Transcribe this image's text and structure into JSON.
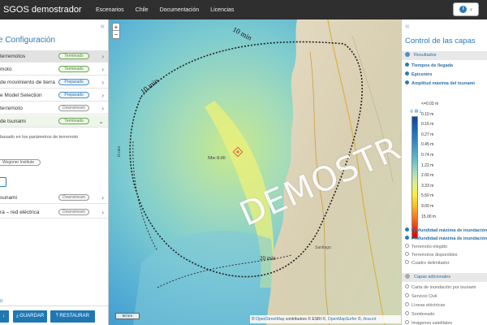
{
  "app": {
    "title": "SGOS demostrador",
    "nav": [
      "Escenarios",
      "Chile",
      "Documentación",
      "Licencias"
    ]
  },
  "left_panel": {
    "title": "e Configuración",
    "workflow": [
      {
        "label": "terremotos",
        "status": "Terminado",
        "state": "selected"
      },
      {
        "label": "moto",
        "status": "Terminado",
        "state": "normal"
      },
      {
        "label": "de movimiento de tierra",
        "status": "Preparado",
        "state": "normal"
      },
      {
        "label": "e Model Selection",
        "status": "Preparado",
        "state": "normal"
      },
      {
        "label": "terremoto",
        "status": "Downstream",
        "state": "normal"
      },
      {
        "label": "de tsunami",
        "status": "Terminado",
        "state": "open"
      }
    ],
    "sub_text": "basado en los parámetros de terremoto",
    "sub_tag": "Wegener Institute",
    "workflow_after": [
      {
        "label": "sunami",
        "status": "Downstream"
      },
      {
        "label": "ra – red eléctrica",
        "status": "Downstream"
      }
    ],
    "footer_label": "n",
    "buttons": {
      "save": "GUARDAR",
      "restore": "RESTAURAR"
    }
  },
  "map": {
    "zoom_in": "+",
    "zoom_out": "−",
    "scale_label": "50 km",
    "contour_labels": [
      "10 min",
      "10 min",
      "20 min",
      "10 min"
    ],
    "epicenter_label": "Mw 8.00",
    "place_labels": [
      "Santiago"
    ],
    "watermark": "DEMOSTRADOR",
    "attribution": {
      "prefix": "©",
      "osm": "OpenStreetMap",
      "mid": " contributors © ESRI ©,",
      "surfer": "OpenMapSurfer",
      "tail": " ©, ",
      "iho": "ihoa.int"
    }
  },
  "right_panel": {
    "title": "Control de las capas",
    "results_header": "Resultados",
    "result_layers": [
      {
        "label": "Tiempos de llegada",
        "on": true
      },
      {
        "label": "Epicentro",
        "on": true
      },
      {
        "label": "Amplitud máxima del tsunami",
        "on": true
      }
    ],
    "legend_tools": "◎ ▤ ⤓",
    "legend": [
      {
        "label": "<=0.03 m",
        "color": "#0d47a1"
      },
      {
        "label": "0.10 m",
        "color": "#1e63b0"
      },
      {
        "label": "0.16 m",
        "color": "#2f7fc0"
      },
      {
        "label": "0.27 m",
        "color": "#4aa0c6"
      },
      {
        "label": "0.45 m",
        "color": "#6cc0c8"
      },
      {
        "label": "0.74 m",
        "color": "#a6dcbc"
      },
      {
        "label": "1.22 m",
        "color": "#d8ef92"
      },
      {
        "label": "2.00 m",
        "color": "#f7f03c"
      },
      {
        "label": "3.33 m",
        "color": "#fcc02a"
      },
      {
        "label": "5.50 m",
        "color": "#f88020"
      },
      {
        "label": "9.00 m",
        "color": "#ee3b14"
      },
      {
        "label": "15.00 m",
        "color": "#d00000"
      }
    ],
    "more_results": [
      {
        "label": "Profundidad máxima de inundación",
        "on": true
      },
      {
        "label": "Profundidad máxima de inundación",
        "on": true
      },
      {
        "label": "Terremoto elegido",
        "on": false
      },
      {
        "label": "Terremotos disponibles",
        "on": false
      },
      {
        "label": "Cuadro delimitador",
        "on": false
      }
    ],
    "additional_header": "Capas adicionales",
    "additional_layers": [
      {
        "label": "Carta de inundación por tsunami",
        "on": false
      },
      {
        "label": "Servicio Civil",
        "on": false
      },
      {
        "label": "Líneas eléctricas",
        "on": false
      },
      {
        "label": "Sombreado",
        "on": false
      },
      {
        "label": "Imágenes satelitales",
        "on": false
      }
    ]
  }
}
